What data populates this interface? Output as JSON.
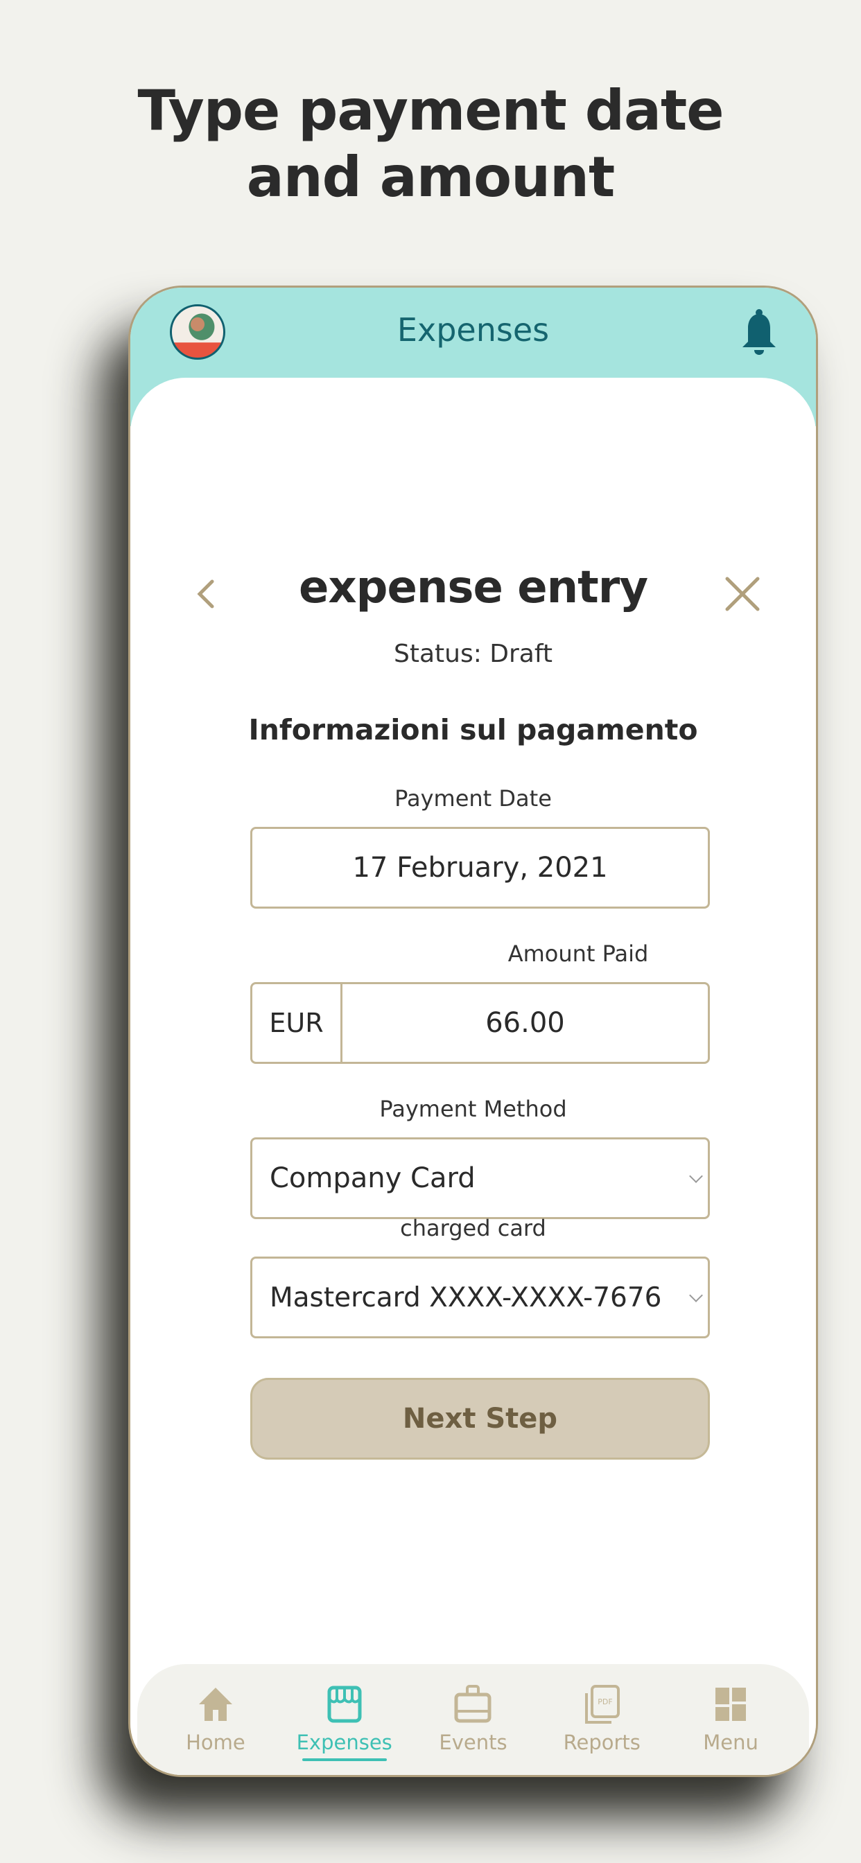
{
  "headline": {
    "line1": "Type payment date",
    "line2": "and amount"
  },
  "app": {
    "title": "Expenses",
    "avatar": "user-avatar",
    "notification_icon": "bell-icon"
  },
  "entry": {
    "title": "expense entry",
    "status": "Status: Draft",
    "section_title": "Informazioni sul pagamento",
    "back_icon": "chevron-left-icon",
    "close_icon": "close-icon"
  },
  "form": {
    "payment_date": {
      "label": "Payment Date",
      "value": "17 February, 2021"
    },
    "amount_paid": {
      "label": "Amount Paid",
      "currency": "EUR",
      "value": "66.00"
    },
    "payment_method": {
      "label": "Payment Method",
      "selected": "Company Card"
    },
    "charged_card": {
      "label": "charged card",
      "selected": "Mastercard XXXX-XXXX-7676"
    },
    "next_button": "Next Step"
  },
  "bottom_nav": {
    "active": "Expenses",
    "items": [
      {
        "label": "Home",
        "icon": "home-icon"
      },
      {
        "label": "Expenses",
        "icon": "storefront-icon"
      },
      {
        "label": "Events",
        "icon": "briefcase-icon"
      },
      {
        "label": "Reports",
        "icon": "pdf-document-icon"
      },
      {
        "label": "Menu",
        "icon": "dashboard-grid-icon"
      }
    ]
  },
  "colors": {
    "background": "#f2f2ed",
    "header_teal": "#a5e4de",
    "header_text": "#15656f",
    "accent_gold": "#b09f7c",
    "button_fill": "#d5cbb7",
    "button_text": "#6e5f42",
    "active_nav": "#3ec0b4",
    "inactive_nav": "#b8aa8c"
  }
}
